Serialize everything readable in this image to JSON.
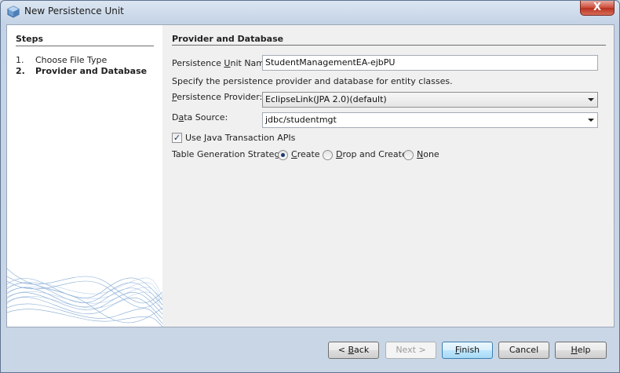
{
  "window": {
    "title": "New Persistence Unit",
    "close_label": "X"
  },
  "steps": {
    "heading": "Steps",
    "items": [
      {
        "num": "1.",
        "label": "Choose File Type",
        "active": false
      },
      {
        "num": "2.",
        "label": "Provider and Database",
        "active": true
      }
    ]
  },
  "panel": {
    "heading": "Provider and Database",
    "unit_name_label": {
      "pre": "Persistence ",
      "mnemonic": "U",
      "post": "nit Name:"
    },
    "unit_name_value": "StudentManagementEA-ejbPU",
    "description": "Specify the persistence provider and database for entity classes.",
    "provider_label": {
      "pre": "",
      "mnemonic": "P",
      "post": "ersistence Provider:"
    },
    "provider_value": "EclipseLink(JPA 2.0)(default)",
    "datasource_label": {
      "pre": "D",
      "mnemonic": "a",
      "post": "ta Source:"
    },
    "datasource_value": "jdbc/studentmgt",
    "jta_label": {
      "pre": "Use ",
      "mnemonic": "J",
      "post": "ava Transaction APIs"
    },
    "jta_checked": true,
    "strategy_label": "Table Generation Strategy:",
    "strategy_options": [
      {
        "pre": "",
        "mnemonic": "C",
        "post": "reate",
        "selected": true
      },
      {
        "pre": "",
        "mnemonic": "D",
        "post": "rop and Create",
        "selected": false
      },
      {
        "pre": "",
        "mnemonic": "N",
        "post": "one",
        "selected": false
      }
    ]
  },
  "buttons": {
    "back": {
      "pre": "< ",
      "mnemonic": "B",
      "post": "ack"
    },
    "next": "Next >",
    "finish": {
      "pre": "",
      "mnemonic": "F",
      "post": "inish"
    },
    "cancel": "Cancel",
    "help": {
      "pre": "",
      "mnemonic": "H",
      "post": "elp"
    }
  },
  "colors": {
    "accent": "#1f3a6e",
    "default_button": "#bee6fd"
  }
}
